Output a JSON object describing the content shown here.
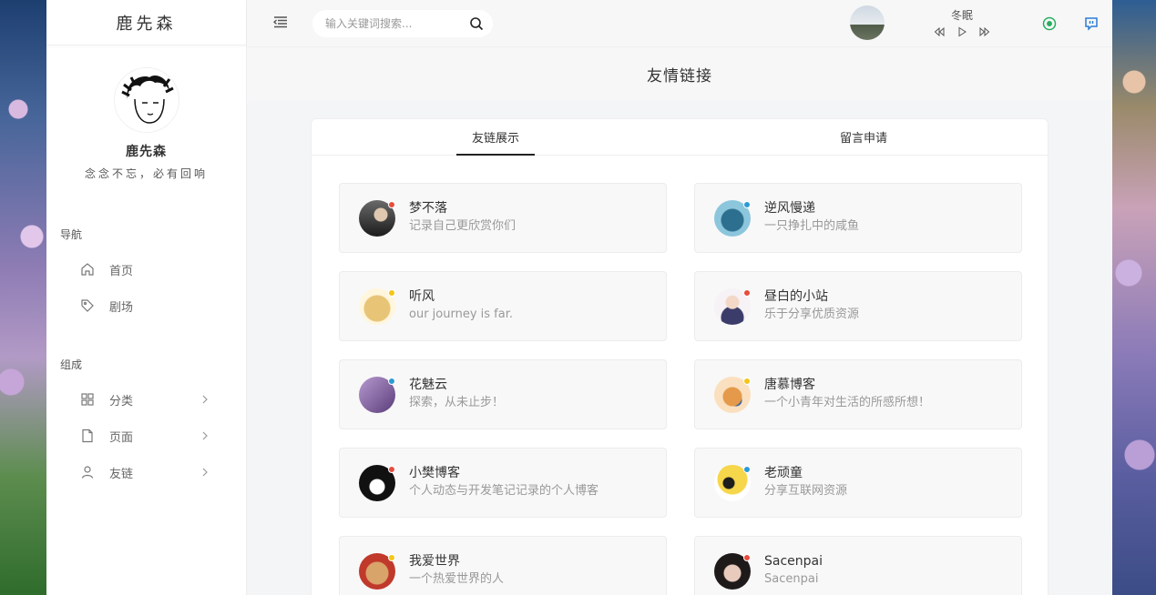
{
  "brand": "鹿先森",
  "profile": {
    "name": "鹿先森",
    "motto": "念念不忘，必有回响"
  },
  "nav": {
    "group1_title": "导航",
    "group1": [
      {
        "label": "首页",
        "icon": "home-icon"
      },
      {
        "label": "剧场",
        "icon": "tag-icon"
      }
    ],
    "group2_title": "组成",
    "group2": [
      {
        "label": "分类",
        "icon": "grid-icon"
      },
      {
        "label": "页面",
        "icon": "file-icon"
      },
      {
        "label": "友链",
        "icon": "user-icon"
      }
    ]
  },
  "search": {
    "placeholder": "输入关键词搜索..."
  },
  "player": {
    "song": "冬眠"
  },
  "page_title": "友情链接",
  "tabs": [
    {
      "label": "友链展示",
      "active": true
    },
    {
      "label": "留言申请",
      "active": false
    }
  ],
  "colors": {
    "dot_red": "#e74c3c",
    "dot_blue": "#2b9bd6",
    "dot_yellow": "#f5c518",
    "accent_green": "#27ae60",
    "accent_blue": "#2b7bd6"
  },
  "links": [
    {
      "name": "梦不落",
      "desc": "记录自己更欣赏你们",
      "dot": "#e74c3c"
    },
    {
      "name": "逆风慢递",
      "desc": "一只挣扎中的咸鱼",
      "dot": "#2b9bd6"
    },
    {
      "name": "听风",
      "desc": "our journey is far.",
      "dot": "#f5c518"
    },
    {
      "name": "昼白的小站",
      "desc": "乐于分享优质资源",
      "dot": "#e74c3c"
    },
    {
      "name": "花魅云",
      "desc": "探索，从未止步！",
      "dot": "#2b9bd6"
    },
    {
      "name": "唐慕博客",
      "desc": "一个小青年对生活的所感所想！",
      "dot": "#f5c518"
    },
    {
      "name": "小樊博客",
      "desc": "个人动态与开发笔记记录的个人博客",
      "dot": "#e74c3c"
    },
    {
      "name": "老顽童",
      "desc": "分享互联网资源",
      "dot": "#2b9bd6"
    },
    {
      "name": "我爱世界",
      "desc": "一个热爱世界的人",
      "dot": "#f5c518"
    },
    {
      "name": "Sacenpai",
      "desc": "Sacenpai",
      "dot": "#e74c3c"
    }
  ]
}
